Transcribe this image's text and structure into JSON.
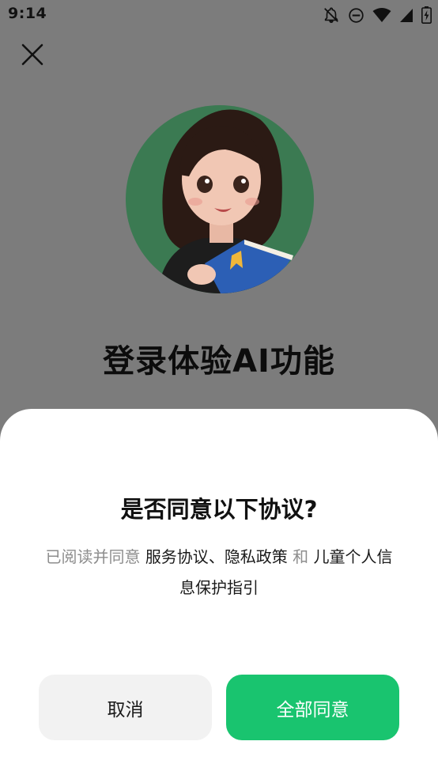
{
  "status_bar": {
    "time": "9:14",
    "icons": [
      "notifications-off-icon",
      "do-not-disturb-icon",
      "wifi-icon",
      "signal-icon",
      "battery-charging-icon"
    ]
  },
  "header": {
    "close_icon": "close-icon"
  },
  "main": {
    "title": "登录体验AI功能"
  },
  "dialog": {
    "title": "是否同意以下协议?",
    "text_prefix": "已阅读并同意 ",
    "link_service": "服务协议",
    "separator": "、",
    "link_privacy": "隐私政策",
    "conjunction": " 和 ",
    "link_children": "儿童个人信息保护指引",
    "cancel_label": "取消",
    "agree_label": "全部同意"
  },
  "colors": {
    "overlay": "#7c7c7c",
    "accent": "#19c46f",
    "cancel_bg": "#f2f2f2",
    "muted_text": "#8d8d8d"
  }
}
